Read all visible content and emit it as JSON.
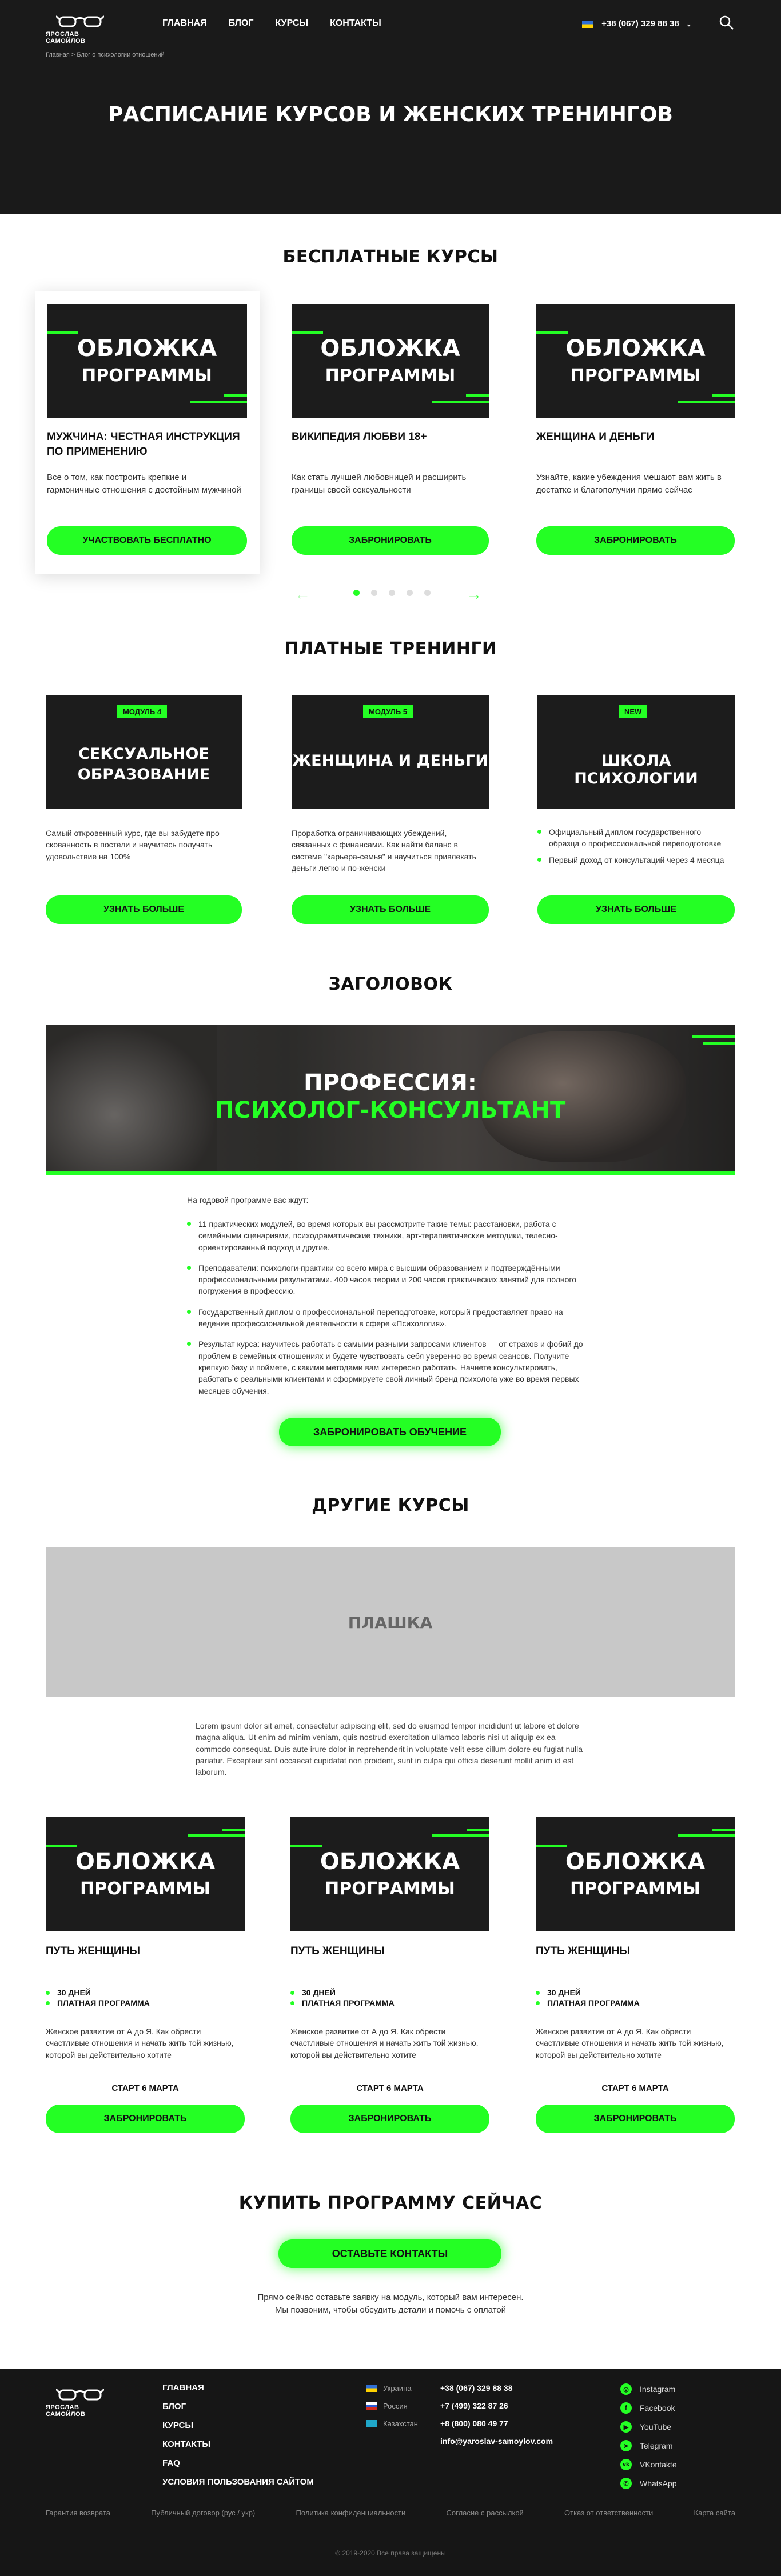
{
  "header": {
    "logo_text": "ЯРОСЛАВ САМОЙЛОВ",
    "nav": [
      "ГЛАВНАЯ",
      "БЛОГ",
      "КУРСЫ",
      "КОНТАКТЫ"
    ],
    "phone": "+38 (067) 329 88 38",
    "breadcrumb": "Главная  >  Блог о психологии отношений",
    "page_title": "РАСПИСАНИЕ КУРСОВ И ЖЕНСКИХ ТРЕНИНГОВ"
  },
  "free_courses": {
    "title": "БЕСПЛАТНЫЕ КУРСЫ",
    "cards": [
      {
        "cover1": "ОБЛОЖКА",
        "cover2": "ПРОГРАММЫ",
        "title": "МУЖЧИНА: ЧЕСТНАЯ ИНСТРУКЦИЯ ПО ПРИМЕНЕНИЮ",
        "desc": "Все о том, как построить крепкие и гармоничные отношения с достойным мужчиной",
        "button": "УЧАСТВОВАТЬ БЕСПЛАТНО"
      },
      {
        "cover1": "ОБЛОЖКА",
        "cover2": "ПРОГРАММЫ",
        "title": "ВИКИПЕДИЯ ЛЮБВИ 18+",
        "desc": "Как стать лучшей любовницей и расширить границы своей сексуальности",
        "button": "ЗАБРОНИРОВАТЬ"
      },
      {
        "cover1": "ОБЛОЖКА",
        "cover2": "ПРОГРАММЫ",
        "title": "ЖЕНЩИНА И ДЕНЬГИ",
        "desc": "Узнайте, какие убеждения мешают вам жить в достатке и благополучии прямо сейчас",
        "button": "ЗАБРОНИРОВАТЬ"
      }
    ],
    "prev_arrow": "←",
    "next_arrow": "→"
  },
  "paid_trainings": {
    "title": "ПЛАТНЫЕ ТРЕНИНГИ",
    "cards": [
      {
        "tag": "МОДУЛЬ 4",
        "cover1": "СЕКСУАЛЬНОЕ",
        "cover2": "ОБРАЗОВАНИЕ",
        "desc": "Самый откровенный курс, где вы забудете про скованность в постели и научитесь получать удовольствие на 100%",
        "button": "УЗНАТЬ БОЛЬШЕ"
      },
      {
        "tag": "МОДУЛЬ 5",
        "cover1": "ЖЕНЩИНА И ДЕНЬГИ",
        "cover2": "",
        "desc": "Проработка ограничивающих убеждений, связанных с финансами. Как найти баланс в системе \"карьера-семья\" и научиться привлекать деньги легко и по-женски",
        "button": "УЗНАТЬ БОЛЬШЕ"
      },
      {
        "tag": "NEW",
        "cover1": "ШКОЛА ПСИХОЛОГИИ",
        "cover2": "",
        "bullets": [
          "Официальный диплом государственного образца о профессиональной переподготовке",
          "Первый доход от консультаций через 4 месяца"
        ],
        "button": "УЗНАТЬ БОЛЬШЕ"
      }
    ]
  },
  "banner_section": {
    "title": "ЗАГОЛОВОК",
    "banner_line1": "ПРОФЕССИЯ:",
    "banner_line2": "ПСИХОЛОГ-КОНСУЛЬТАНТ",
    "intro": "На годовой программе вас ждут:",
    "bullets": [
      "11 практических модулей, во время которых вы рассмотрите такие темы: расстановки, работа с семейными сценариями, психодраматические техники, арт-терапевтические методики, телесно-ориентированный подход и другие.",
      "Преподаватели: психологи-практики со всего мира с высшим образованием и подтверждёнными профессиональными результатами. 400 часов теории и 200 часов практических занятий для полного погружения в профессию.",
      "Государственный диплом о профессиональной переподготовке, который предоставляет право на ведение профессиональной деятельности в сфере «Психология».",
      "Результат курса: научитесь работать с самыми разными запросами клиентов — от страхов и фобий до проблем в семейных отношениях и будете чувствовать себя уверенно во время сеансов. Получите крепкую базу и поймете, с какими методами вам интересно работать. Начнете консультировать, работать с реальными клиентами и сформируете свой личный бренд психолога уже во время первых месяцев обучения."
    ],
    "button": "ЗАБРОНИРОВАТЬ ОБУЧЕНИЕ"
  },
  "other_courses": {
    "title": "ДРУГИЕ КУРСЫ",
    "placeholder": "ПЛАШКА",
    "lorem": "Lorem ipsum dolor sit amet, consectetur adipiscing elit, sed do eiusmod tempor incididunt ut labore et dolore magna aliqua. Ut enim ad minim veniam, quis nostrud exercitation ullamco laboris nisi ut aliquip ex ea commodo consequat. Duis aute irure dolor in reprehenderit in voluptate velit esse cillum dolore eu fugiat nulla pariatur. Excepteur sint occaecat cupidatat non proident, sunt in culpa qui officia deserunt mollit anim id est laborum.",
    "cards": [
      {
        "cover1": "ОБЛОЖКА",
        "cover2": "ПРОГРАММЫ",
        "title": "ПУТЬ ЖЕНЩИНЫ",
        "b1": "30 ДНЕЙ",
        "b2": "ПЛАТНАЯ ПРОГРАММА",
        "desc": "Женское развитие от А до Я. Как обрести счастливые отношения и начать жить той жизнью, которой вы действительно хотите",
        "start": "СТАРТ 6 МАРТА",
        "button": "ЗАБРОНИРОВАТЬ"
      },
      {
        "cover1": "ОБЛОЖКА",
        "cover2": "ПРОГРАММЫ",
        "title": "ПУТЬ ЖЕНЩИНЫ",
        "b1": "30 ДНЕЙ",
        "b2": "ПЛАТНАЯ ПРОГРАММА",
        "desc": "Женское развитие от А до Я. Как обрести счастливые отношения и начать жить той жизнью, которой вы действительно хотите",
        "start": "СТАРТ 6 МАРТА",
        "button": "ЗАБРОНИРОВАТЬ"
      },
      {
        "cover1": "ОБЛОЖКА",
        "cover2": "ПРОГРАММЫ",
        "title": "ПУТЬ ЖЕНЩИНЫ",
        "b1": "30 ДНЕЙ",
        "b2": "ПЛАТНАЯ ПРОГРАММА",
        "desc": "Женское развитие от А до Я. Как обрести счастливые отношения и начать жить той жизнью, которой вы действительно хотите",
        "start": "СТАРТ 6 МАРТА",
        "button": "ЗАБРОНИРОВАТЬ"
      }
    ]
  },
  "cta": {
    "title": "КУПИТЬ ПРОГРАММУ СЕЙЧАС",
    "button": "ОСТАВЬТЕ КОНТАКТЫ",
    "line1": "Прямо сейчас оставьте заявку на модуль, который вам интересен.",
    "line2": "Мы позвоним, чтобы обсудить детали и помочь с оплатой"
  },
  "footer": {
    "logo_text": "ЯРОСЛАВ САМОЙЛОВ",
    "nav": [
      "ГЛАВНАЯ",
      "БЛОГ",
      "КУРСЫ",
      "КОНТАКТЫ",
      "FAQ",
      "УСЛОВИЯ ПОЛЬЗОВАНИЯ САЙТОМ"
    ],
    "contacts": [
      {
        "country": "Украина",
        "phone": "+38 (067) 329 88 38"
      },
      {
        "country": "Россия",
        "phone": "+7 (499) 322 87 26"
      },
      {
        "country": "Казахстан",
        "phone": "+8 (800) 080 49 77"
      }
    ],
    "email": "info@yaroslav-samoylov.com",
    "social": [
      "Instagram",
      "Facebook",
      "YouTube",
      "Telegram",
      "VKontakte",
      "WhatsApp"
    ],
    "social_icons": [
      "instagram-icon",
      "facebook-icon",
      "youtube-icon",
      "telegram-icon",
      "vkontakte-icon",
      "whatsapp-icon"
    ],
    "links": [
      "Гарантия возврата",
      "Публичный договор (рус / укр)",
      "Политика конфиденциальности",
      "Согласие с рассылкой",
      "Отказ от ответственности",
      "Карта сайта"
    ],
    "copyright": "© 2019-2020 Все права защищены"
  },
  "colors": {
    "accent": "#24ff24",
    "dark": "#1a1a1a"
  }
}
